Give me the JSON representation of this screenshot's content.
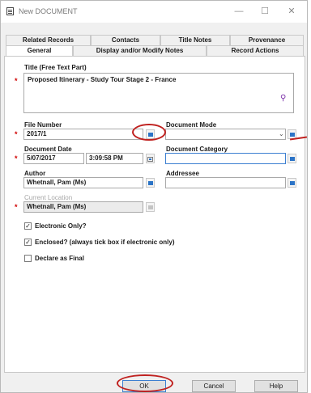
{
  "window": {
    "title": "New DOCUMENT"
  },
  "titlebar_controls": {
    "minimize": "—",
    "maximize": "☐",
    "close": "✕"
  },
  "tabs_top": [
    "Related Records",
    "Contacts",
    "Title Notes",
    "Provenance"
  ],
  "tabs_bottom": [
    "General",
    "Display and/or Modify Notes",
    "Record Actions"
  ],
  "active_tab": "General",
  "form": {
    "title_label": "Title (Free Text Part)",
    "title_value": "Proposed Itinerary - Study Tour Stage 2 - France",
    "file_number_label": "File Number",
    "file_number_value": "2017/1",
    "document_mode_label": "Document Mode",
    "document_mode_value": "",
    "document_date_label": "Document Date",
    "document_date_value": "5/07/2017",
    "document_time_value": "3:09:58 PM",
    "document_category_label": "Document Category",
    "document_category_value": "",
    "author_label": "Author",
    "author_value": "Whetnall, Pam (Ms)",
    "addressee_label": "Addressee",
    "addressee_value": "",
    "current_location_label": "Current Location",
    "current_location_value": "Whetnall, Pam (Ms)",
    "required_marker": "*"
  },
  "checkboxes": [
    {
      "label": "Electronic Only?",
      "checked": true
    },
    {
      "label": "Enclosed? (always tick box if electronic only)",
      "checked": true
    },
    {
      "label": "Declare as Final",
      "checked": false
    }
  ],
  "buttons": {
    "ok": "OK",
    "cancel": "Cancel",
    "help": "Help"
  },
  "colors": {
    "required": "#d00000",
    "annotation": "#c0211f",
    "accent": "#2c74c7"
  }
}
